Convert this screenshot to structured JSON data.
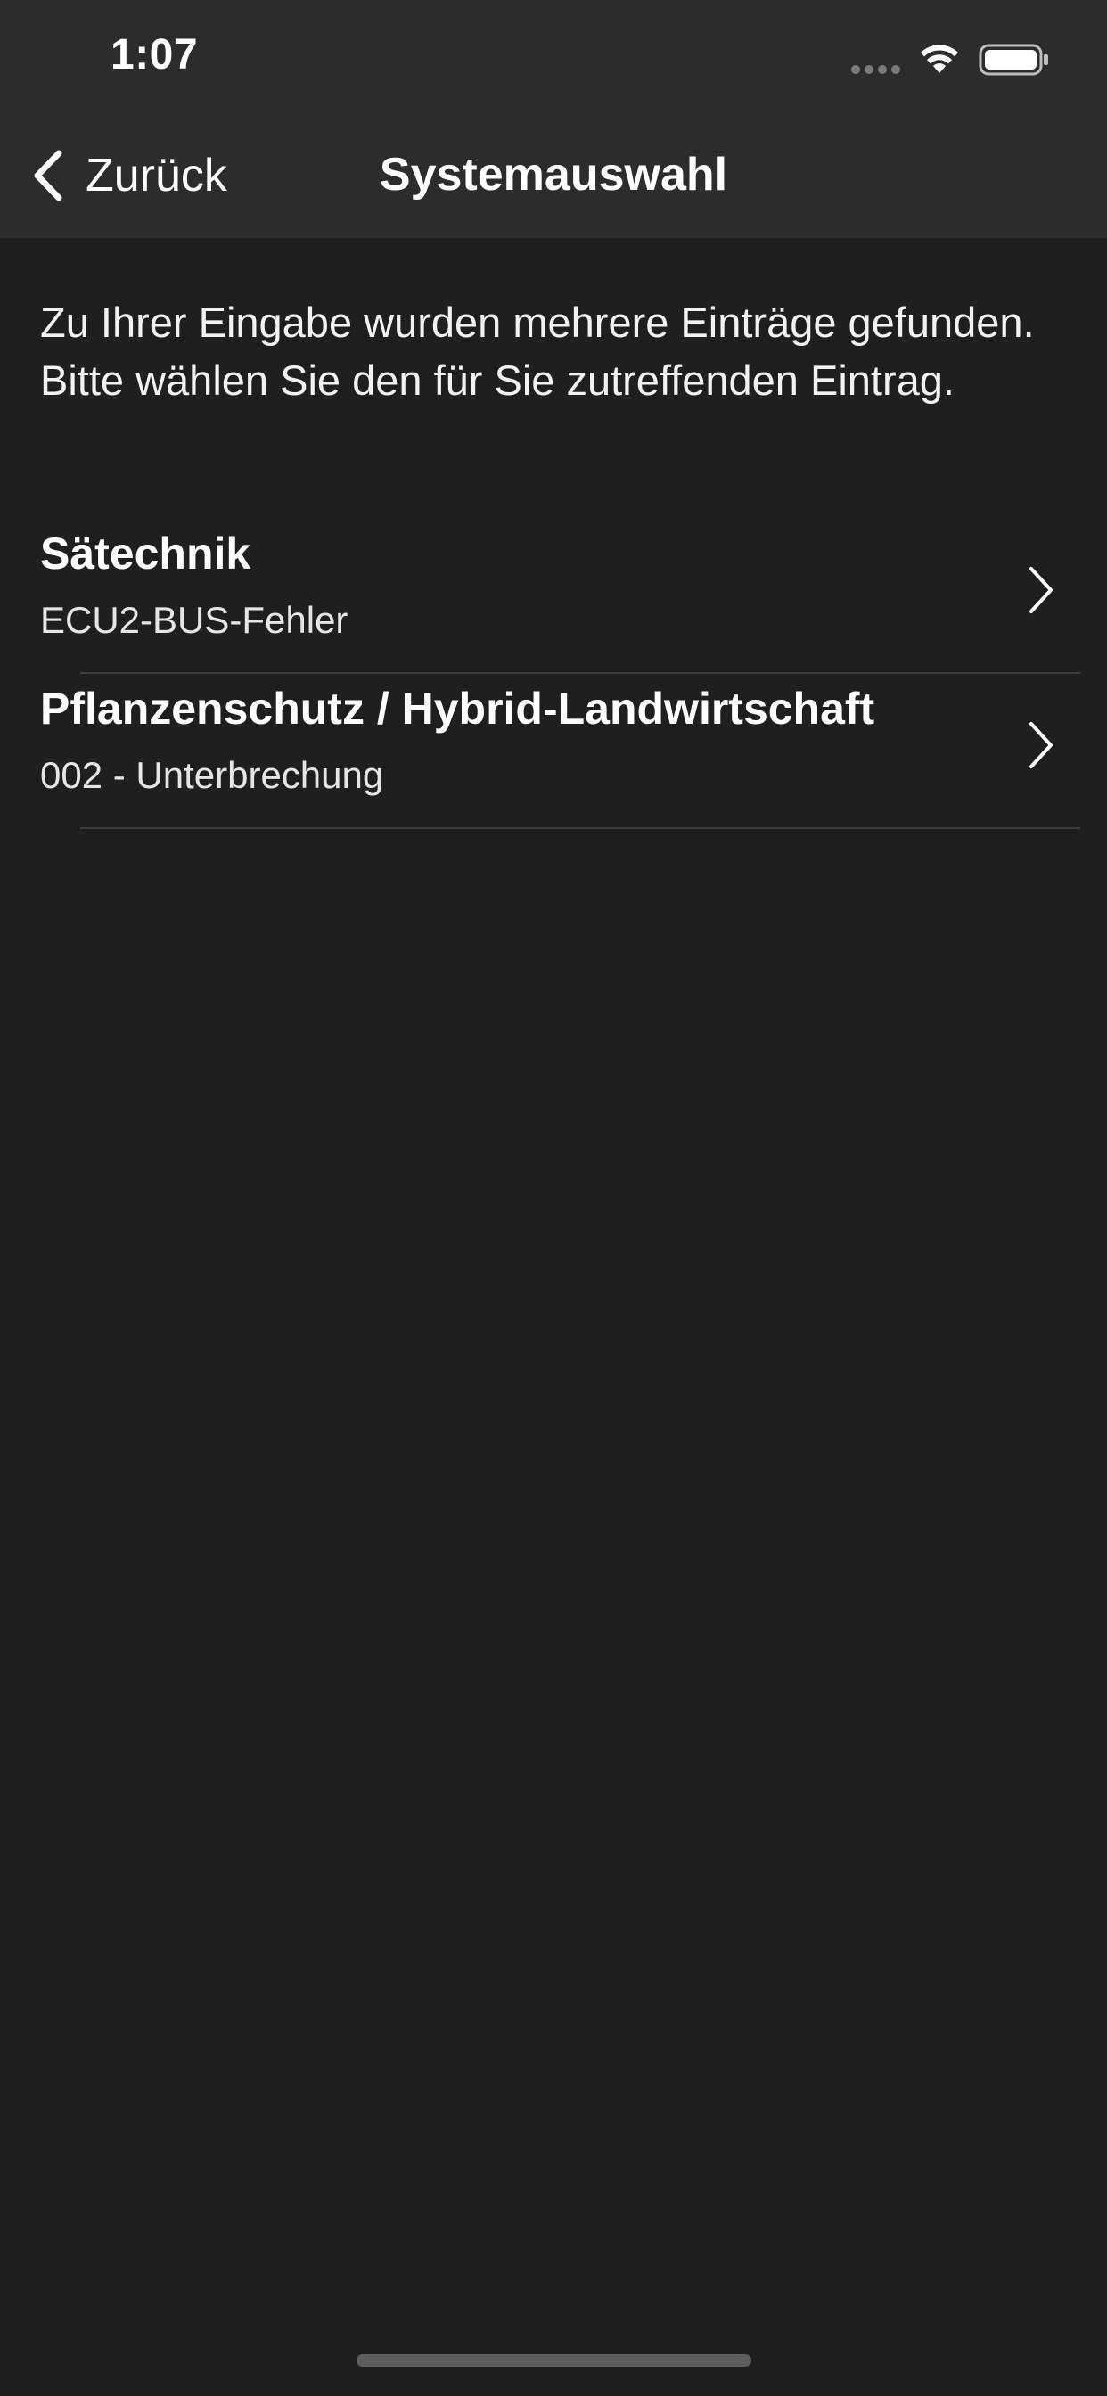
{
  "status_bar": {
    "time": "1:07"
  },
  "nav": {
    "back_label": "Zurück",
    "title": "Systemauswahl"
  },
  "intro_text": "Zu Ihrer Eingabe wurden mehrere Einträge gefunden. Bitte wählen Sie den für Sie zutreffenden Eintrag.",
  "items": [
    {
      "title": "Sätechnik",
      "subtitle": "ECU2-BUS-Fehler"
    },
    {
      "title": "Pflanzenschutz / Hybrid-Landwirtschaft",
      "subtitle": "002 - Unterbrechung"
    }
  ],
  "colors": {
    "background": "#1f1f1f",
    "navbar": "#2c2c2c",
    "text": "#ffffff",
    "divider": "#3c3c3c"
  },
  "icons": {
    "back": "chevron-left-icon",
    "disclosure": "chevron-right-icon",
    "wifi": "wifi-icon",
    "battery": "battery-icon"
  }
}
